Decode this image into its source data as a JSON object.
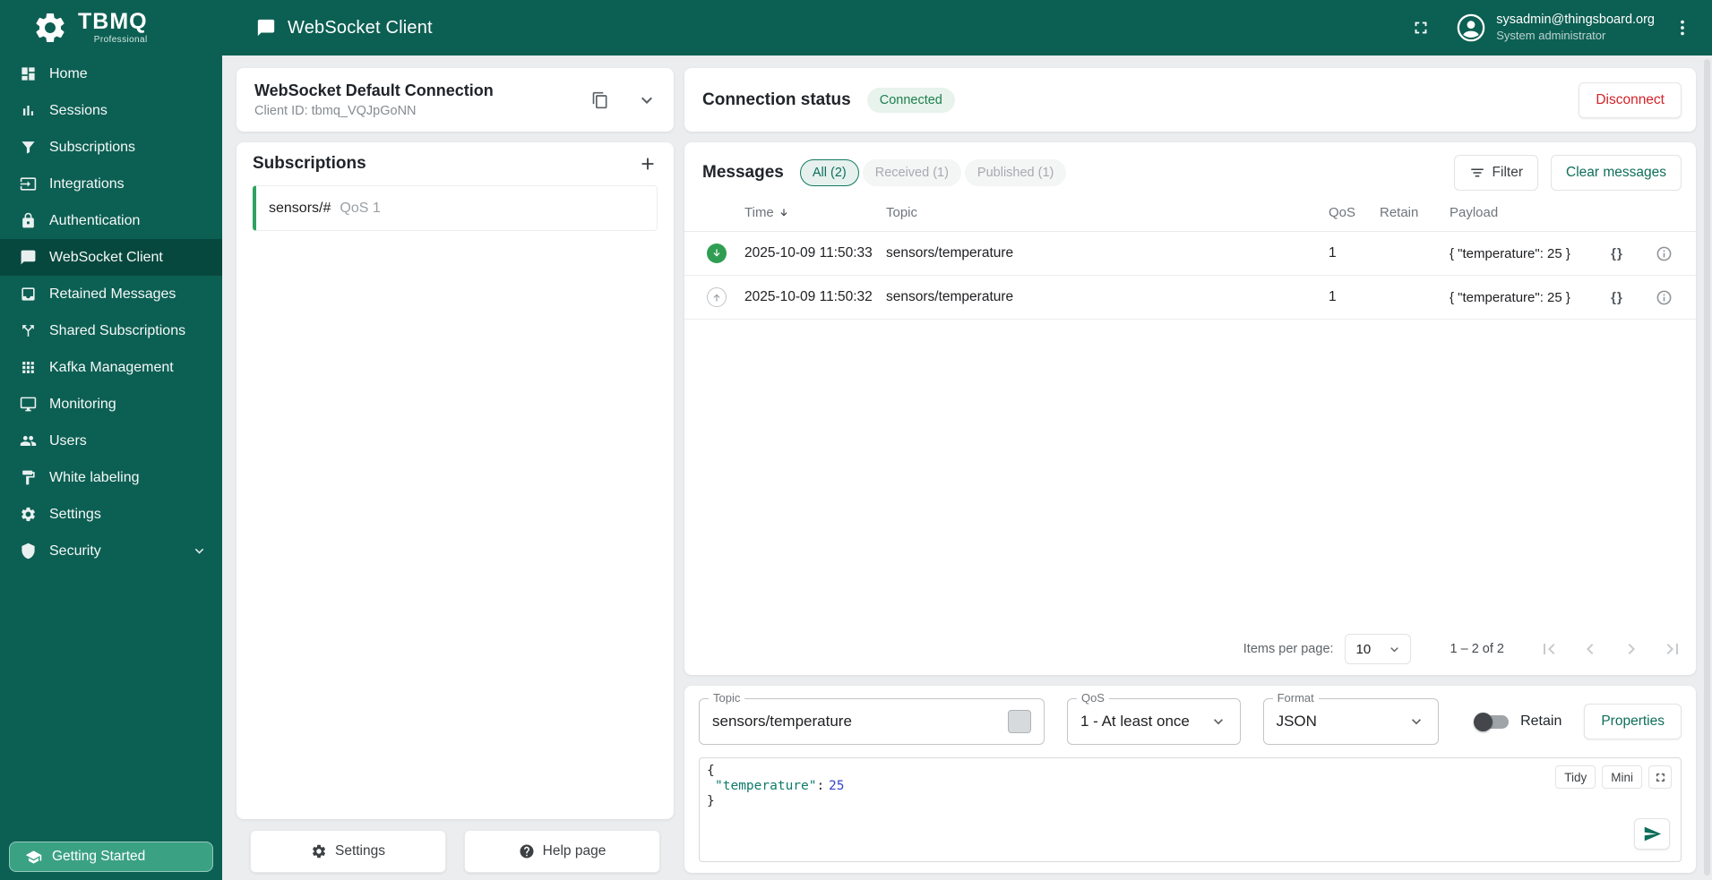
{
  "colors": {
    "primary_teal": "#0c5f53",
    "accent_teal": "#0d6e5a",
    "connected_green": "#1e7e4e",
    "disconnect_red": "#d3222a",
    "received_green": "#2f9e53",
    "subscription_green": "#2ea35f"
  },
  "sidebar": {
    "logo_title": "TBMQ",
    "logo_subtitle": "Professional",
    "items": [
      {
        "label": "Home",
        "icon": "home-icon"
      },
      {
        "label": "Sessions",
        "icon": "sessions-chart-icon"
      },
      {
        "label": "Subscriptions",
        "icon": "funnel-icon"
      },
      {
        "label": "Integrations",
        "icon": "input-icon"
      },
      {
        "label": "Authentication",
        "icon": "lock-icon"
      },
      {
        "label": "WebSocket Client",
        "icon": "chat-icon"
      },
      {
        "label": "Retained Messages",
        "icon": "inbox-icon"
      },
      {
        "label": "Shared Subscriptions",
        "icon": "split-icon"
      },
      {
        "label": "Kafka Management",
        "icon": "grid-icon"
      },
      {
        "label": "Monitoring",
        "icon": "monitor-icon"
      },
      {
        "label": "Users",
        "icon": "users-icon"
      },
      {
        "label": "White labeling",
        "icon": "paint-icon"
      },
      {
        "label": "Settings",
        "icon": "gear-icon"
      },
      {
        "label": "Security",
        "icon": "shield-icon"
      }
    ],
    "getting_started": "Getting Started"
  },
  "header": {
    "title": "WebSocket Client",
    "user_email": "sysadmin@thingsboard.org",
    "user_role": "System administrator"
  },
  "connection": {
    "name": "WebSocket Default Connection",
    "client_id": "Client ID: tbmq_VQJpGoNN",
    "status_title": "Connection status",
    "status": "Connected",
    "disconnect_label": "Disconnect"
  },
  "subscriptions": {
    "title": "Subscriptions",
    "items": [
      {
        "topic": "sensors/#",
        "qos": "QoS 1"
      }
    ]
  },
  "left_footer": {
    "settings_label": "Settings",
    "help_label": "Help page"
  },
  "messages": {
    "title": "Messages",
    "filters": [
      {
        "label": "All (2)",
        "selected": true
      },
      {
        "label": "Received (1)",
        "selected": false
      },
      {
        "label": "Published (1)",
        "selected": false
      }
    ],
    "filter_button": "Filter",
    "clear_button": "Clear messages",
    "columns": [
      "Time",
      "Topic",
      "QoS",
      "Retain",
      "Payload"
    ],
    "rows": [
      {
        "direction": "received",
        "time": "2025-10-09 11:50:33",
        "topic": "sensors/temperature",
        "qos": "1",
        "retain": "",
        "payload": "{ \"temperature\": 25 }"
      },
      {
        "direction": "published",
        "time": "2025-10-09 11:50:32",
        "topic": "sensors/temperature",
        "qos": "1",
        "retain": "",
        "payload": "{ \"temperature\": 25 }"
      }
    ],
    "pagination": {
      "items_per_page_label": "Items per page:",
      "page_size": "10",
      "range_label": "1 – 2 of 2"
    }
  },
  "publish": {
    "topic_label": "Topic",
    "topic_value": "sensors/temperature",
    "qos_label": "QoS",
    "qos_value": "1 - At least once",
    "format_label": "Format",
    "format_value": "JSON",
    "retain_label": "Retain",
    "properties_label": "Properties",
    "editor": {
      "open": "{",
      "key": "\"temperature\"",
      "colon": ":",
      "value": "25",
      "close": "}",
      "tidy": "Tidy",
      "mini": "Mini"
    }
  }
}
